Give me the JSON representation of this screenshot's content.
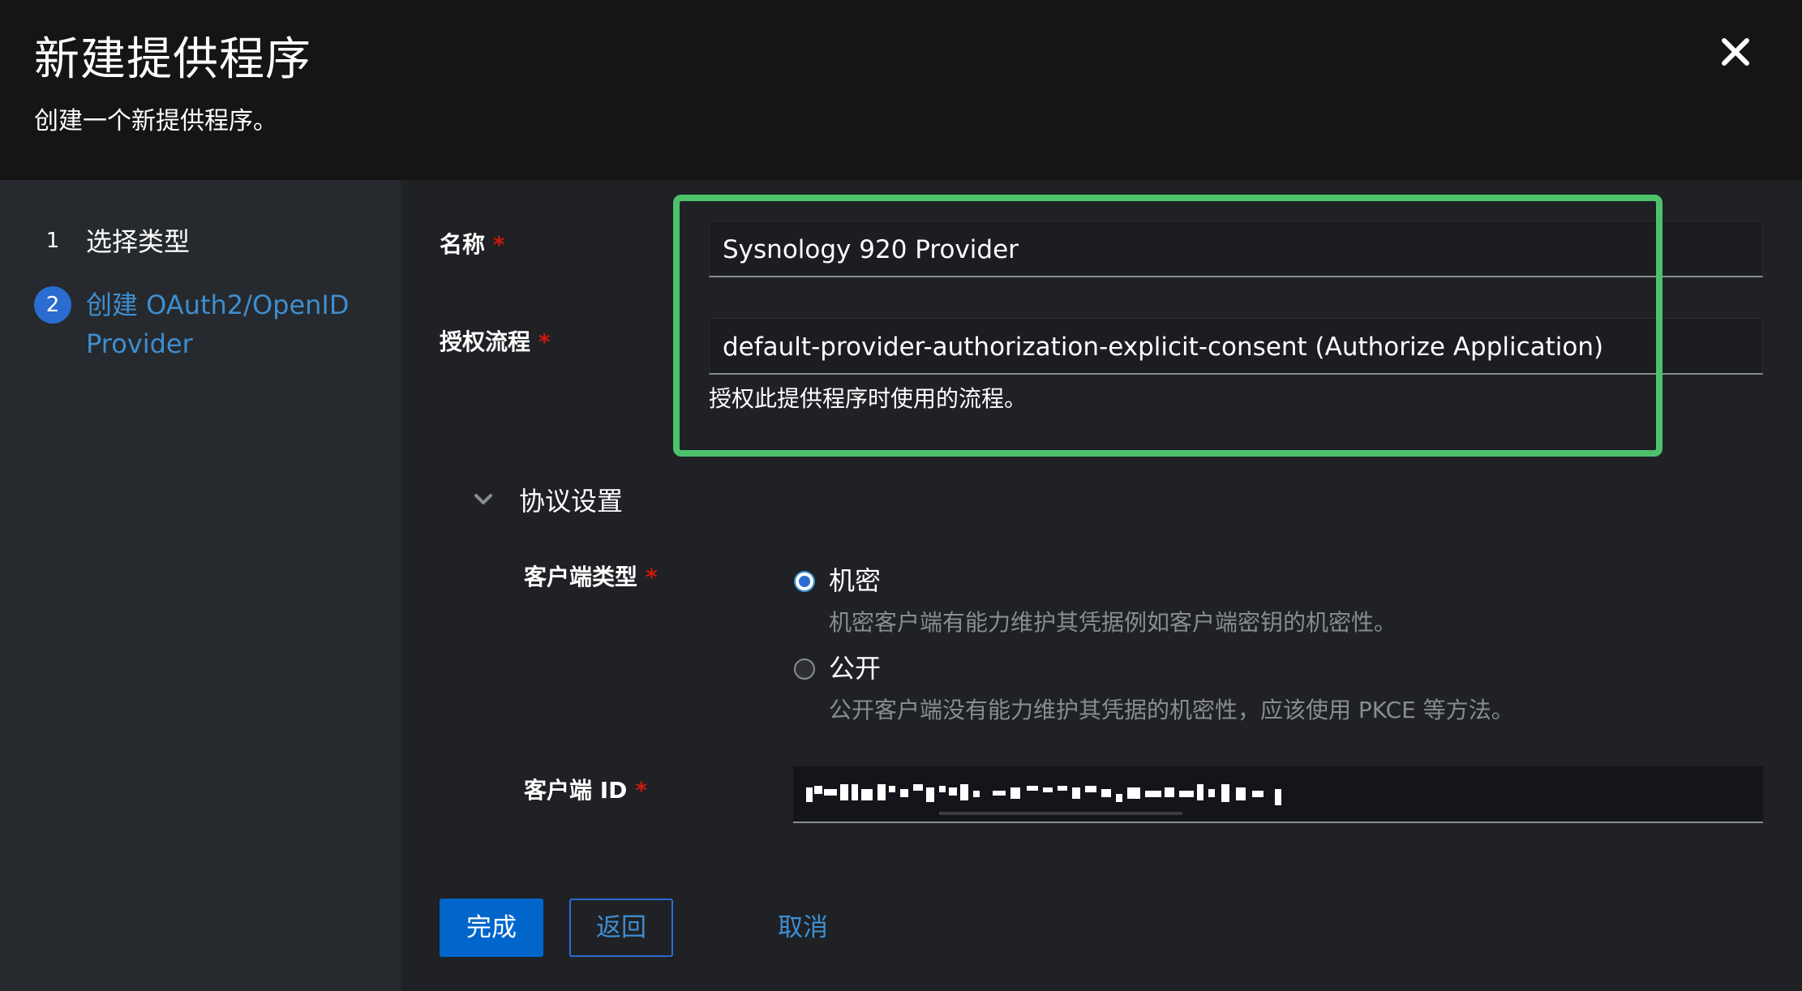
{
  "modal": {
    "title": "新建提供程序",
    "subtitle": "创建一个新提供程序。"
  },
  "wizard": {
    "steps": [
      {
        "number": "1",
        "label": "选择类型"
      },
      {
        "number": "2",
        "label_line1": "创建 OAuth2/OpenID",
        "label_line2": "Provider"
      }
    ]
  },
  "form": {
    "name": {
      "label": "名称",
      "required": "*",
      "value": "Sysnology 920 Provider"
    },
    "flow": {
      "label": "授权流程",
      "required": "*",
      "value": "default-provider-authorization-explicit-consent (Authorize Application)",
      "helper": "授权此提供程序时使用的流程。"
    },
    "protocol": {
      "section_label": "协议设置",
      "client_type": {
        "label": "客户端类型",
        "required": "*",
        "options": [
          {
            "label": "机密",
            "description": "机密客户端有能力维护其凭据例如客户端密钥的机密性。",
            "selected": true
          },
          {
            "label": "公开",
            "description": "公开客户端没有能力维护其凭据的机密性，应该使用 PKCE 等方法。",
            "selected": false
          }
        ]
      },
      "client_id": {
        "label": "客户端 ID",
        "required": "*"
      }
    }
  },
  "buttons": {
    "finish": "完成",
    "back": "返回",
    "cancel": "取消"
  },
  "colors": {
    "accent": "#3e8ed0",
    "primary_button": "#0066cc",
    "highlight": "#4cc26d",
    "required": "#c9190b"
  }
}
